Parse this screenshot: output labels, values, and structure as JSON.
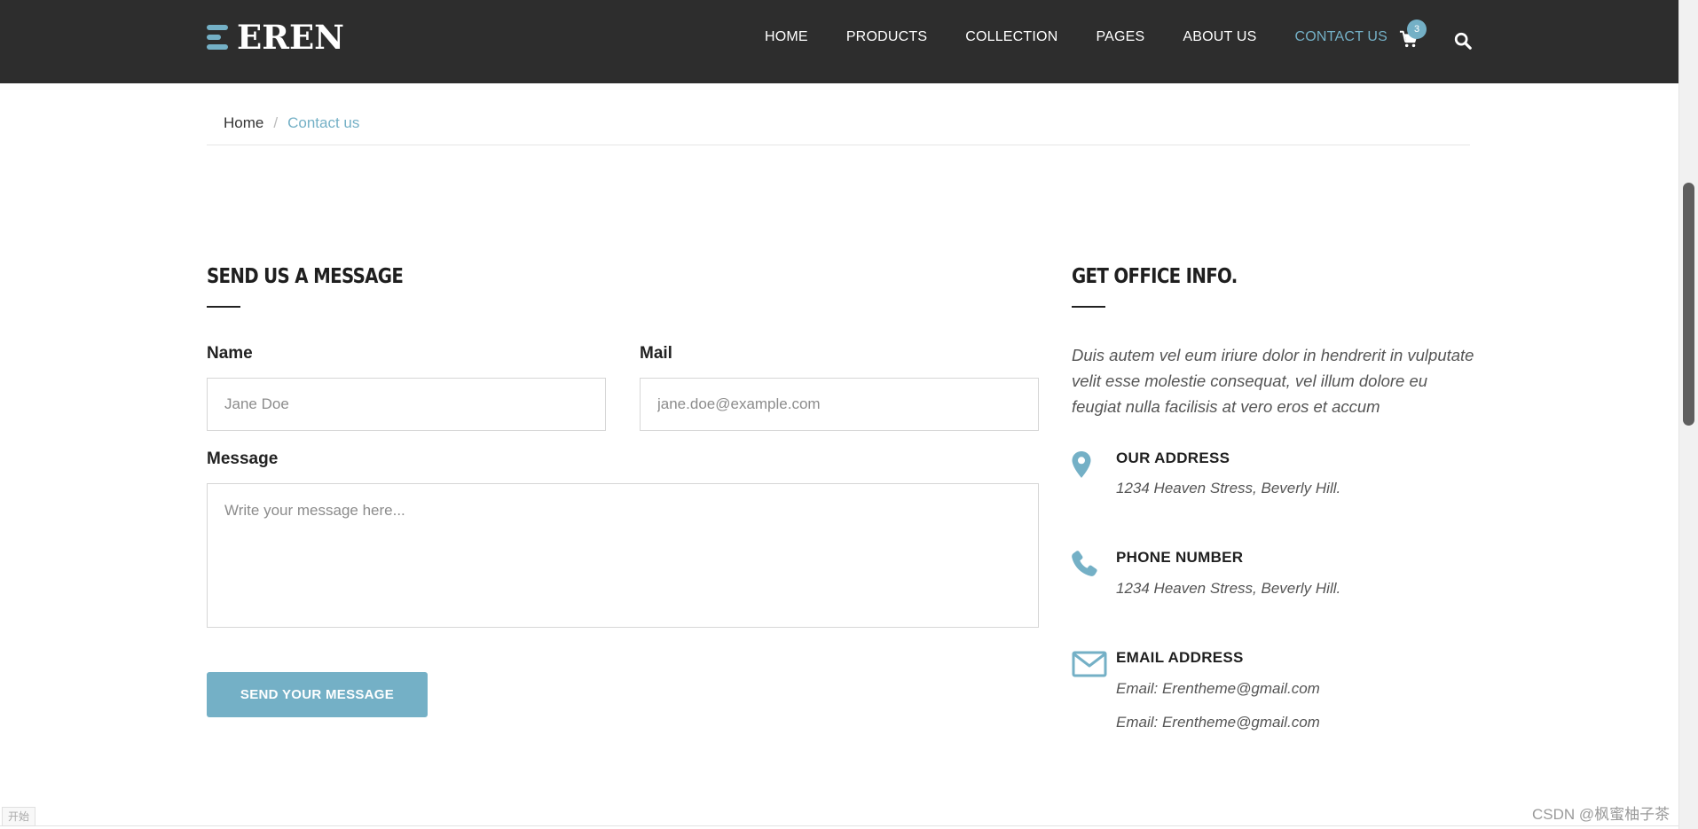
{
  "brand": {
    "name": "EREN",
    "accent": "#74b0c6",
    "header_bg": "#2d2d2d"
  },
  "nav": {
    "items": [
      {
        "label": "HOME",
        "active": false
      },
      {
        "label": "PRODUCTS",
        "active": false
      },
      {
        "label": "COLLECTION",
        "active": false
      },
      {
        "label": "PAGES",
        "active": false
      },
      {
        "label": "ABOUT US",
        "active": false
      },
      {
        "label": "CONTACT US",
        "active": true
      }
    ],
    "cart_count": "3",
    "cart_icon": "shopping-cart-icon",
    "search_icon": "search-icon"
  },
  "breadcrumb": {
    "home": "Home",
    "separator": "/",
    "current": "Contact us"
  },
  "form": {
    "title": "SEND US A MESSAGE",
    "name_label": "Name",
    "name_placeholder": "Jane Doe",
    "name_value": "",
    "mail_label": "Mail",
    "mail_placeholder": "jane.doe@example.com",
    "mail_value": "",
    "message_label": "Message",
    "message_placeholder": "Write your message here...",
    "message_value": "",
    "submit_label": "SEND YOUR MESSAGE"
  },
  "office": {
    "title": "GET OFFICE INFO.",
    "intro": "Duis autem vel eum iriure dolor in hendrerit in vulputate velit esse molestie consequat, vel illum dolore eu feugiat nulla facilisis at vero eros et accum",
    "address": {
      "icon": "map-pin-icon",
      "heading": "OUR ADDRESS",
      "line": "1234 Heaven Stress, Beverly Hill."
    },
    "phone": {
      "icon": "phone-icon",
      "heading": "PHONE NUMBER",
      "line": "1234 Heaven Stress, Beverly Hill."
    },
    "email": {
      "icon": "envelope-icon",
      "heading": "EMAIL ADDRESS",
      "line1": "Email: Erentheme@gmail.com",
      "line2": "Email: Erentheme@gmail.com"
    }
  },
  "watermark": "CSDN @枫蜜柚子茶",
  "corner_tab": "开始"
}
